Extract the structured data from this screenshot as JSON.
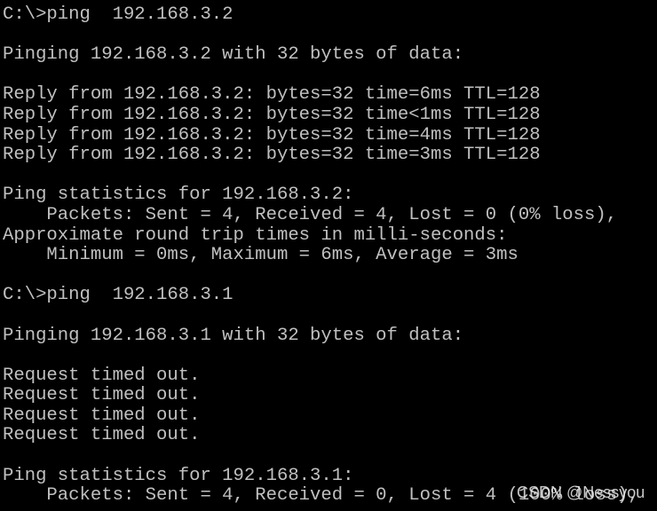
{
  "terminal": {
    "lines": [
      "C:\\>ping  192.168.3.2",
      "",
      "Pinging 192.168.3.2 with 32 bytes of data:",
      "",
      "Reply from 192.168.3.2: bytes=32 time=6ms TTL=128",
      "Reply from 192.168.3.2: bytes=32 time<1ms TTL=128",
      "Reply from 192.168.3.2: bytes=32 time=4ms TTL=128",
      "Reply from 192.168.3.2: bytes=32 time=3ms TTL=128",
      "",
      "Ping statistics for 192.168.3.2:",
      "    Packets: Sent = 4, Received = 4, Lost = 0 (0% loss),",
      "Approximate round trip times in milli-seconds:",
      "    Minimum = 0ms, Maximum = 6ms, Average = 3ms",
      "",
      "C:\\>ping  192.168.3.1",
      "",
      "Pinging 192.168.3.1 with 32 bytes of data:",
      "",
      "Request timed out.",
      "Request timed out.",
      "Request timed out.",
      "Request timed out.",
      "",
      "Ping statistics for 192.168.3.1:",
      "    Packets: Sent = 4, Received = 0, Lost = 4 (100% loss),"
    ]
  },
  "watermark": "CSDN @Nessyou",
  "colors": {
    "background": "#000000",
    "text": "#c0c0c0"
  }
}
